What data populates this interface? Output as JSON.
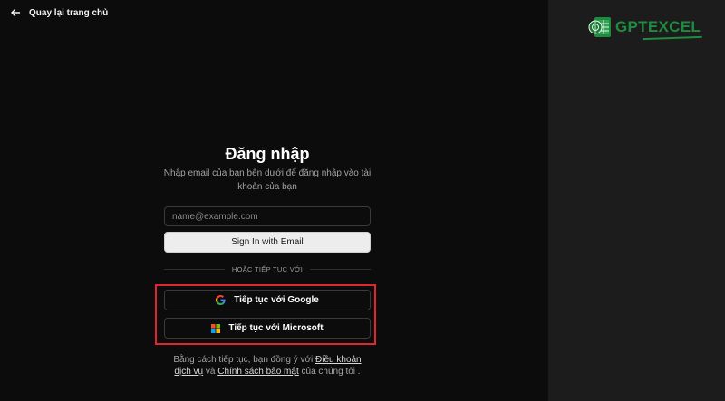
{
  "nav": {
    "back_label": "Quay lại trang chủ"
  },
  "brand": {
    "name": "GPTEXCEL",
    "color": "#1f8b3f"
  },
  "login": {
    "title": "Đăng nhập",
    "subtitle": "Nhập email của bạn bên dưới để đăng nhập vào tài khoản của bạn",
    "email_placeholder": "name@example.com",
    "email_value": "",
    "signin_label": "Sign In with Email",
    "divider_label": "HOẶC TIẾP TỤC VỚI",
    "google_label": "Tiếp tục với Google",
    "microsoft_label": "Tiếp tục với Microsoft"
  },
  "terms": {
    "prefix": "Bằng cách tiếp tục, bạn đồng ý với ",
    "tos_link": "Điều khoản dịch vụ",
    "middle": " và ",
    "privacy_link": "Chính sách bảo mật",
    "suffix": " của chúng tôi ."
  },
  "colors": {
    "highlight": "#e0272f",
    "background": "#0c0c0c",
    "sidebar": "#1c1c1c"
  }
}
